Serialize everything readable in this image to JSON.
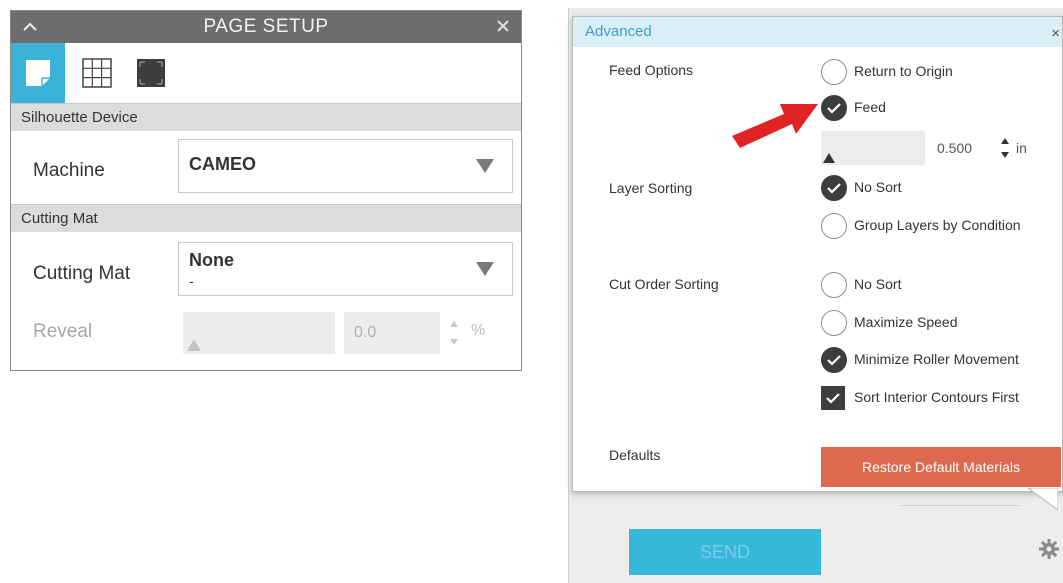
{
  "page_setup": {
    "title": "PAGE SETUP",
    "sections": {
      "device": "Silhouette Device",
      "mat": "Cutting Mat"
    },
    "machine": {
      "label": "Machine",
      "value": "CAMEO"
    },
    "cutting_mat": {
      "label": "Cutting Mat",
      "value": "None",
      "subvalue": "-"
    },
    "reveal": {
      "label": "Reveal",
      "value": "0.0",
      "unit": "%"
    },
    "tabs": [
      "page-tab",
      "grid-tab",
      "bleed-tab"
    ]
  },
  "advanced": {
    "title": "Advanced",
    "close": "×",
    "feed_options": {
      "label": "Feed Options",
      "options": [
        {
          "label": "Return to Origin",
          "selected": false
        },
        {
          "label": "Feed",
          "selected": true
        }
      ],
      "feed_value": "0.500",
      "feed_unit": "in"
    },
    "layer_sorting": {
      "label": "Layer Sorting",
      "options": [
        {
          "label": "No Sort",
          "selected": true
        },
        {
          "label": "Group Layers by Condition",
          "selected": false
        }
      ]
    },
    "cut_order_sorting": {
      "label": "Cut Order Sorting",
      "options": [
        {
          "label": "No Sort",
          "selected": false
        },
        {
          "label": "Maximize Speed",
          "selected": false
        },
        {
          "label": "Minimize Roller Movement",
          "selected": true
        }
      ],
      "checkbox": {
        "label": "Sort Interior Contours First",
        "checked": true
      }
    },
    "defaults": {
      "label": "Defaults",
      "button": "Restore Default Materials"
    }
  },
  "send_button": "SEND",
  "colors": {
    "accent": "#3bb3d9",
    "restore": "#dd6a4f",
    "arrow": "#e02424",
    "titlebar": "#6d6d6d"
  }
}
